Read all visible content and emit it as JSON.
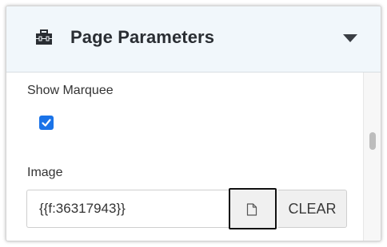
{
  "panel": {
    "title": "Page Parameters",
    "title_icon": "toolbox-icon",
    "collapse_icon": "caret-down-icon"
  },
  "fields": {
    "show_marquee": {
      "label": "Show Marquee",
      "checked": true
    },
    "image": {
      "label": "Image",
      "value": "{{f:36317943}}",
      "file_button_icon": "file-icon",
      "clear_label": "CLEAR"
    }
  },
  "colors": {
    "header_background": "#f1f7fb",
    "checkbox_accent": "#1a73e8",
    "title_text": "#2a2e33"
  }
}
